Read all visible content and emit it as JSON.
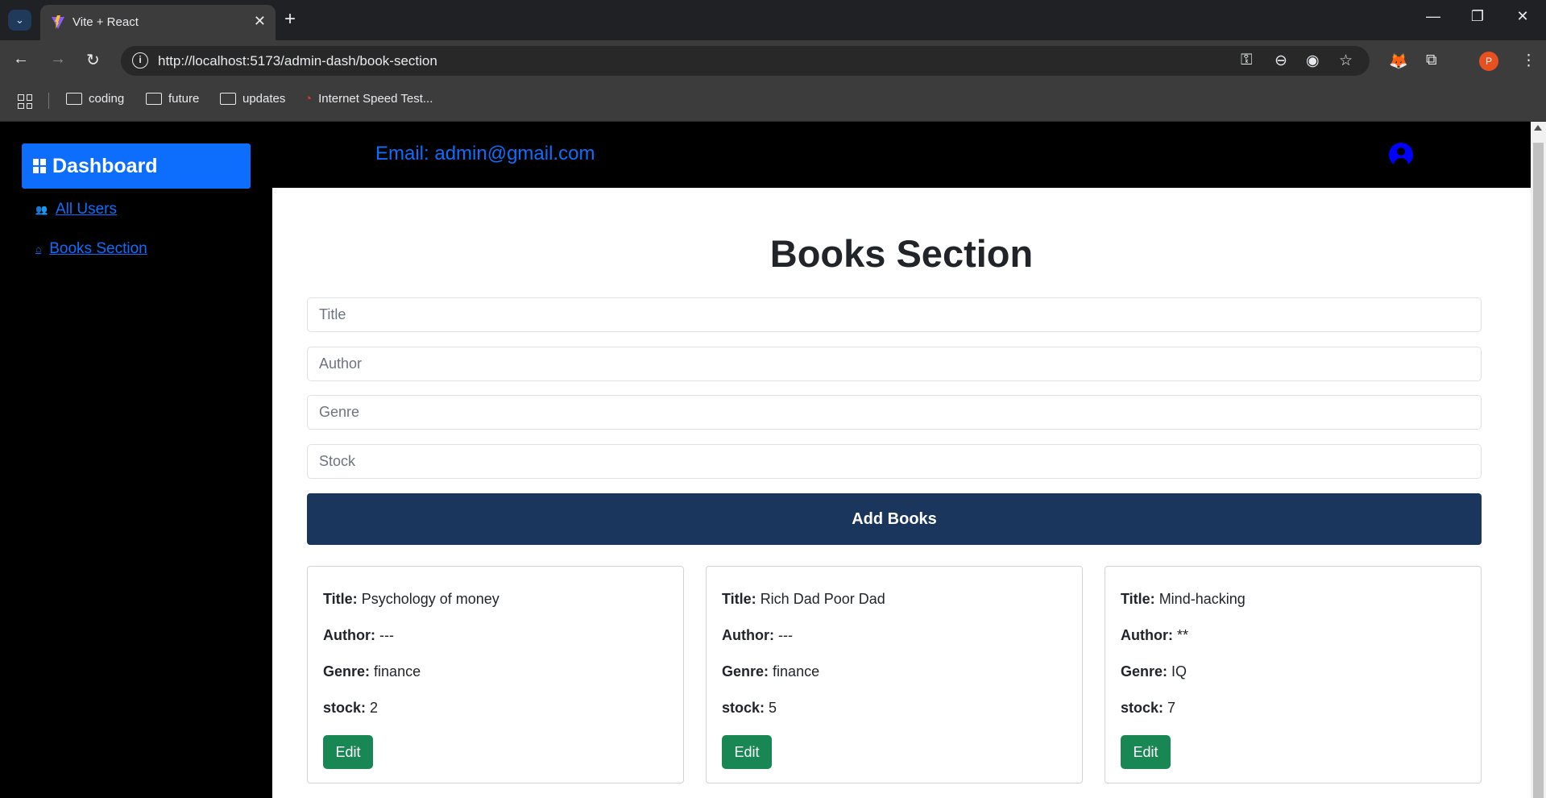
{
  "browser": {
    "tab_title": "Vite + React",
    "url": "http://localhost:5173/admin-dash/book-section",
    "profile_initial": "P",
    "bookmarks": [
      "coding",
      "future",
      "updates",
      "Internet Speed Test..."
    ]
  },
  "sidebar": {
    "dashboard_label": "Dashboard",
    "items": [
      {
        "label": " All Users",
        "icon": "users-icon"
      },
      {
        "label": " Books Section",
        "icon": "home-icon"
      }
    ]
  },
  "header": {
    "email": "Email: admin@gmail.com"
  },
  "main": {
    "title": "Books Section",
    "form": {
      "title_placeholder": "Title",
      "author_placeholder": "Author",
      "genre_placeholder": "Genre",
      "stock_placeholder": "Stock",
      "submit_label": "Add Books"
    },
    "labels": {
      "title": "Title:",
      "author": "Author:",
      "genre": "Genre:",
      "stock": "stock:",
      "edit": "Edit"
    },
    "books": [
      {
        "title": "Psychology of money",
        "author": "---",
        "genre": "finance",
        "stock": "2"
      },
      {
        "title": "Rich Dad Poor Dad",
        "author": "---",
        "genre": "finance",
        "stock": "5"
      },
      {
        "title": "Mind-hacking",
        "author": "**",
        "genre": "IQ",
        "stock": "7"
      }
    ]
  },
  "colors": {
    "primary": "#0d6efd",
    "add_button": "#1a365d",
    "edit_button": "#198754"
  }
}
